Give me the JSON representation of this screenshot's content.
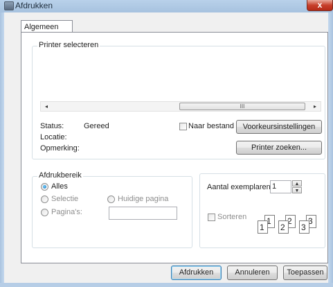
{
  "window": {
    "title": "Afdrukken",
    "close_label": "x"
  },
  "tabs": [
    {
      "label": "Algemeen"
    }
  ],
  "printer_group": {
    "label": "Printer selecteren",
    "status_label": "Status:",
    "status_value": "Gereed",
    "location_label": "Locatie:",
    "location_value": "",
    "comment_label": "Opmerking:",
    "comment_value": "",
    "print_to_file_label": "Naar bestand",
    "preferences_button": "Voorkeursinstellingen",
    "find_printer_button": "Printer zoeken...",
    "scroll_thumb_glyph": "III",
    "scroll_left_glyph": "◂",
    "scroll_right_glyph": "▸"
  },
  "range_group": {
    "label": "Afdrukbereik",
    "all_label": "Alles",
    "selection_label": "Selectie",
    "current_page_label": "Huidige pagina",
    "pages_label": "Pagina's:",
    "pages_value": "",
    "selected": "all"
  },
  "copies_group": {
    "copies_label": "Aantal exemplaren:",
    "copies_value": "1",
    "collate_label": "Sorteren",
    "collate_checked": false,
    "collate_pages": [
      {
        "back": "1",
        "front": "1"
      },
      {
        "back": "2",
        "front": "2"
      },
      {
        "back": "3",
        "front": "3"
      }
    ]
  },
  "buttons": {
    "print": "Afdrukken",
    "cancel": "Annuleren",
    "apply": "Toepassen"
  },
  "colors": {
    "titlebar": "#b9d1ea",
    "close": "#c7402c",
    "dialog_bg": "#f0f0f0",
    "default_button_border": "#3c7fb1"
  }
}
